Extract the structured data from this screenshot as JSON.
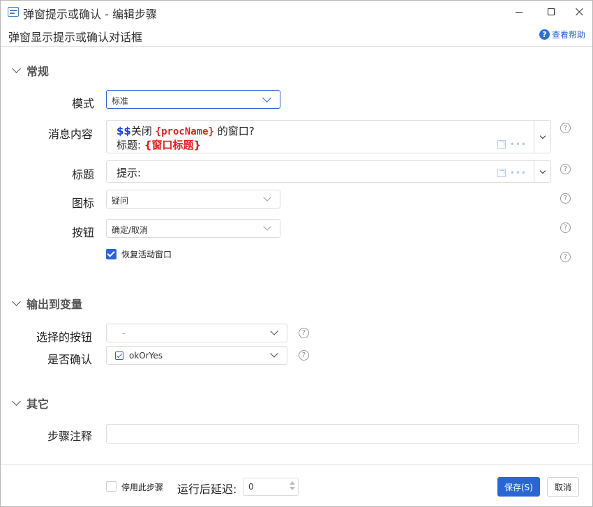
{
  "window": {
    "title": "弹窗提示或确认  -  编辑步骤",
    "subtitle": "弹窗显示提示或确认对话框",
    "help_label": "查看帮助",
    "help_icon": "question-circle-icon"
  },
  "sections": {
    "general": {
      "title": "常规",
      "mode": {
        "label": "模式",
        "value": "标准"
      },
      "message": {
        "label": "消息内容",
        "line1_prefix": "$$",
        "line1_text_a": "关闭 ",
        "line1_var": "{procName}",
        "line1_text_b": " 的窗口?",
        "line2_text": "标题: ",
        "line2_var": "{窗口标题}"
      },
      "title_field": {
        "label": "标题",
        "value": "提示:"
      },
      "icon": {
        "label": "图标",
        "value": "疑问"
      },
      "buttons": {
        "label": "按钮",
        "value": "确定/取消"
      },
      "restore_window": {
        "label": "恢复活动窗口",
        "checked": true
      }
    },
    "output": {
      "title": "输出到变量",
      "selected_button": {
        "label": "选择的按钮",
        "value": "-"
      },
      "is_confirm": {
        "label": "是否确认",
        "value": "okOrYes"
      }
    },
    "other": {
      "title": "其它",
      "step_note": {
        "label": "步骤注释",
        "value": ""
      }
    }
  },
  "footer": {
    "disable_step_label": "停用此步骤",
    "delay_label": "运行后延迟:",
    "delay_value": "0",
    "save_label": "保存(S)",
    "cancel_label": "取消"
  },
  "colors": {
    "accent": "#2a66d3",
    "variable": "#e02020",
    "dollar": "#1b3fd8"
  }
}
